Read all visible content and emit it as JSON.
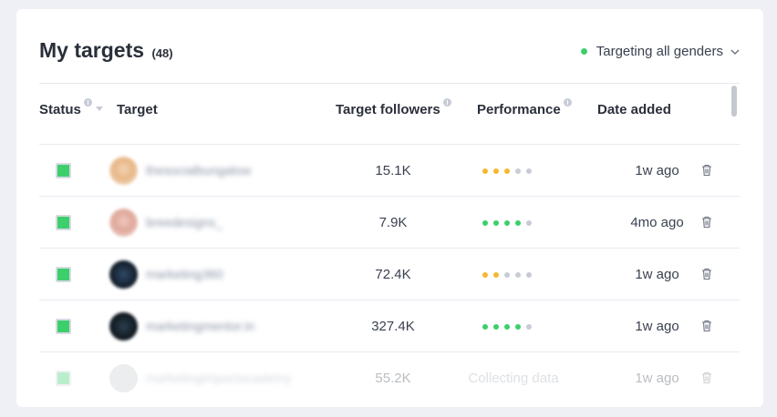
{
  "header": {
    "title": "My targets",
    "count": "(48)",
    "gender_filter": "Targeting all genders"
  },
  "columns": {
    "status": "Status",
    "target": "Target",
    "followers": "Target followers",
    "performance": "Performance",
    "date": "Date added"
  },
  "colors": {
    "accent_green": "#3ccf6b",
    "perf_orange": "#f5b731",
    "perf_gray": "#c7ccd6"
  },
  "rows": [
    {
      "username": "thesocialbungalow",
      "followers": "15.1K",
      "performance": 3,
      "perf_color": "orange",
      "date": "1w ago"
    },
    {
      "username": "breedesigns_",
      "followers": "7.9K",
      "performance": 4,
      "perf_color": "green",
      "date": "4mo ago"
    },
    {
      "username": "marketing360",
      "followers": "72.4K",
      "performance": 2,
      "perf_color": "orange",
      "date": "1w ago"
    },
    {
      "username": "marketingmentor.in",
      "followers": "327.4K",
      "performance": 4,
      "perf_color": "green",
      "date": "1w ago"
    },
    {
      "username": "marketingimpactacademy",
      "followers": "55.2K",
      "performance_text": "Collecting data",
      "date": "1w ago"
    }
  ]
}
